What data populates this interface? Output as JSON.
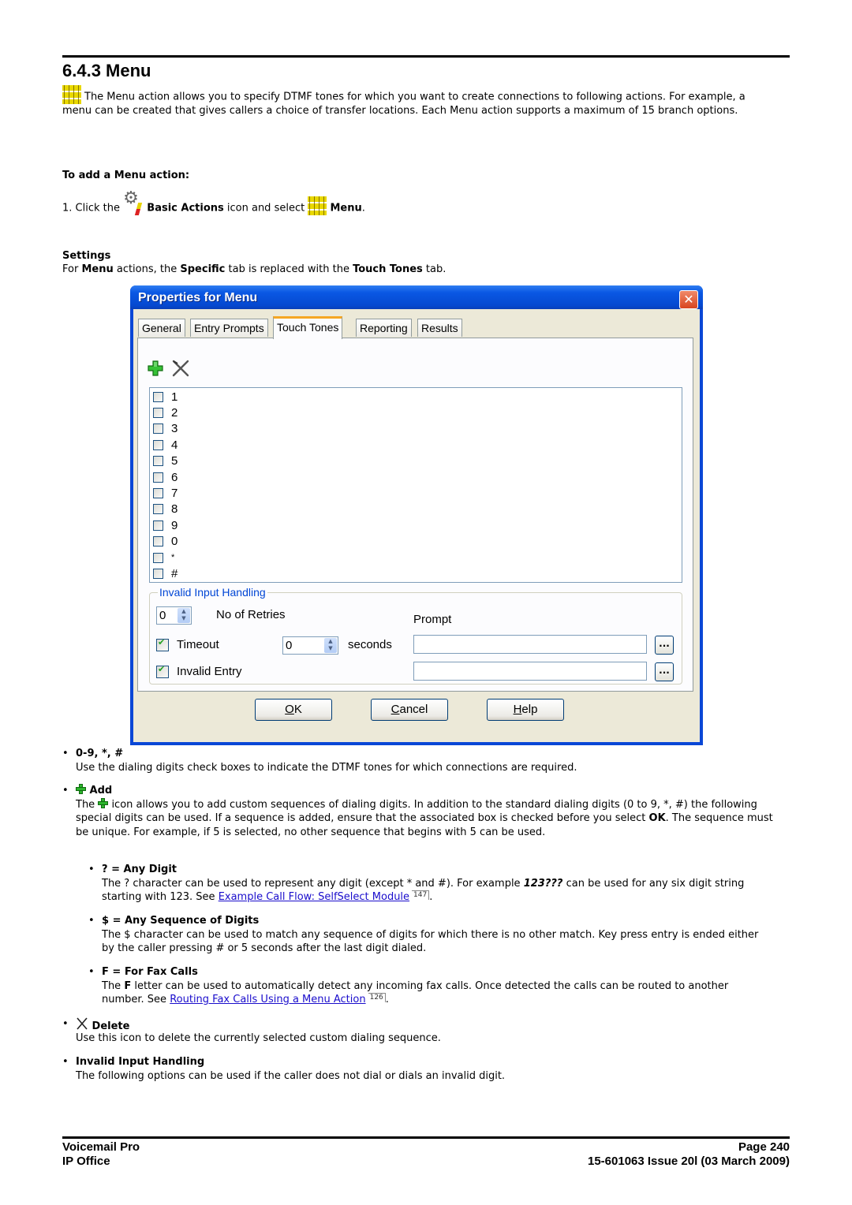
{
  "section": {
    "title": "6.4.3 Menu",
    "intro": "The Menu action allows you to specify DTMF tones for which you want to create connections to following actions. For example, a menu can be created that gives callers a choice of transfer locations. Each Menu action supports a maximum of 15 branch options."
  },
  "howto": {
    "heading": "To add a Menu action:",
    "step_num": "1.",
    "step_pre": "Click the",
    "step_bold1": "Basic Actions",
    "step_mid": "icon and select",
    "step_bold2": "Menu",
    "step_end": "."
  },
  "settings": {
    "heading": "Settings",
    "t1": "For ",
    "b1": "Menu",
    "t2": " actions, the ",
    "b2": "Specific",
    "t3": " tab is replaced with the ",
    "b3": "Touch Tones",
    "t4": " tab."
  },
  "dialog": {
    "title": "Properties for Menu",
    "close_glyph": "✕",
    "tabs": [
      {
        "label": "General",
        "active": false
      },
      {
        "label": "Entry Prompts",
        "active": false
      },
      {
        "label": "Touch Tones",
        "active": true
      },
      {
        "label": "Reporting",
        "active": false
      },
      {
        "label": "Results",
        "active": false
      }
    ],
    "digits": [
      {
        "label": "1",
        "checked": false
      },
      {
        "label": "2",
        "checked": false
      },
      {
        "label": "3",
        "checked": false
      },
      {
        "label": "4",
        "checked": false
      },
      {
        "label": "5",
        "checked": false
      },
      {
        "label": "6",
        "checked": false
      },
      {
        "label": "7",
        "checked": false
      },
      {
        "label": "8",
        "checked": false
      },
      {
        "label": "9",
        "checked": false
      },
      {
        "label": "0",
        "checked": false
      },
      {
        "label": "*",
        "checked": false
      },
      {
        "label": "#",
        "checked": false
      }
    ],
    "invalid_group": {
      "legend": "Invalid Input Handling",
      "retries_value": "0",
      "retries_label": "No of Retries",
      "prompt_label": "Prompt",
      "timeout_label": "Timeout",
      "timeout_checked": true,
      "timeout_value": "0",
      "seconds_label": "seconds",
      "timeout_prompt": "",
      "invalid_entry_label": "Invalid Entry",
      "invalid_entry_checked": true,
      "invalid_entry_prompt": "",
      "browse_label": "..."
    },
    "buttons": {
      "ok_key": "O",
      "ok_rest": "K",
      "cancel_key": "C",
      "cancel_rest": "ancel",
      "help_key": "H",
      "help_rest": "elp"
    }
  },
  "bullets": {
    "digits": {
      "heading": "0-9, *, #",
      "text": "Use the dialing digits check boxes to indicate the DTMF tones for which connections are required."
    },
    "add": {
      "heading": "Add",
      "text_pre": "The ",
      "text_post": " icon allows you to add custom sequences of dialing digits. In addition to the standard dialing digits (0 to 9, *, #) the following special digits can be used. If a sequence is added, ensure that the associated box is checked before you select ",
      "text_bold": "OK",
      "text_end": ". The sequence must be unique. For example, if 5 is selected, no other sequence that begins with 5 can be used."
    },
    "any_digit": {
      "heading": "? = Any Digit",
      "text_pre": "The ? character can be used to represent any digit (except * and #). For example ",
      "text_bolditalic": "123???",
      "text_post": " can be used for any six digit string starting with 123. See ",
      "link": "Example Call Flow: SelfSelect Module",
      "page_ref": "147",
      "text_end": "."
    },
    "any_sequence": {
      "heading": "$ = Any Sequence of Digits",
      "text": "The $ character can be used to match any sequence of digits for which there is no other match. Key press entry is ended either by the caller pressing # or 5 seconds after the last digit dialed."
    },
    "fax": {
      "heading": "F = For Fax Calls",
      "text_pre": "The ",
      "text_bold": "F",
      "text_post": " letter can be used to automatically detect any incoming fax calls. Once detected the calls can be routed to another number. See ",
      "link": "Routing Fax Calls Using a Menu Action",
      "page_ref": "126",
      "text_end": "."
    },
    "delete": {
      "heading": "Delete",
      "text": "Use this icon to delete the currently selected custom dialing sequence."
    },
    "invalid": {
      "heading": "Invalid Input Handling",
      "text": "The following options can be used if the caller does not dial or dials an invalid digit."
    }
  },
  "footer": {
    "left_top": "Voicemail Pro",
    "left_bottom": "IP Office",
    "right_top": "Page 240",
    "right_bottom": "15-601063 Issue 20l (03 March 2009)"
  }
}
